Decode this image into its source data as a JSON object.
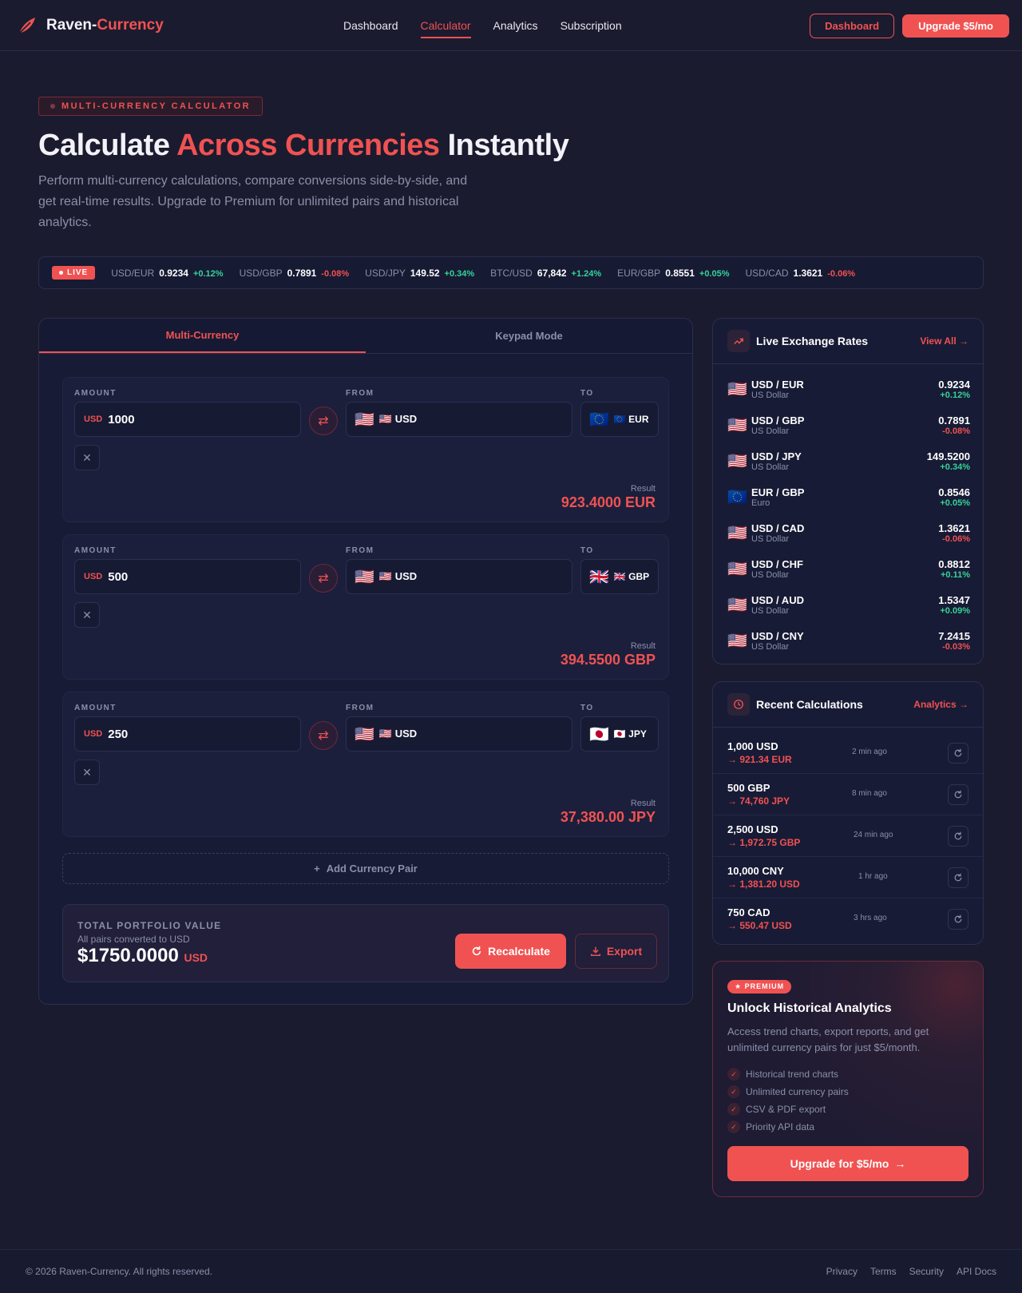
{
  "brand": {
    "name_a": "Raven-",
    "name_b": "Currency"
  },
  "nav": {
    "links": [
      "Dashboard",
      "Calculator",
      "Analytics",
      "Subscription"
    ],
    "dashboard_btn": "Dashboard",
    "upgrade_btn": "Upgrade $5/mo"
  },
  "hero": {
    "badge": "MULTI-CURRENCY CALCULATOR",
    "title_a": "Calculate ",
    "title_b": "Across Currencies",
    "title_c": " Instantly",
    "subtitle": "Perform multi-currency calculations, compare conversions side-by-side, and get real-time results. Upgrade to Premium for unlimited pairs and historical analytics."
  },
  "ticker": {
    "live": "LIVE",
    "items": [
      {
        "pair": "USD/EUR",
        "value": "0.9234",
        "change": "+0.12%",
        "dir": "up"
      },
      {
        "pair": "USD/GBP",
        "value": "0.7891",
        "change": "-0.08%",
        "dir": "down"
      },
      {
        "pair": "USD/JPY",
        "value": "149.52",
        "change": "+0.34%",
        "dir": "up"
      },
      {
        "pair": "BTC/USD",
        "value": "67,842",
        "change": "+1.24%",
        "dir": "up"
      },
      {
        "pair": "EUR/GBP",
        "value": "0.8551",
        "change": "+0.05%",
        "dir": "up"
      },
      {
        "pair": "USD/CAD",
        "value": "1.3621",
        "change": "-0.06%",
        "dir": "down"
      }
    ]
  },
  "calculator": {
    "tabs": [
      "Multi-Currency",
      "Keypad Mode"
    ],
    "labels": {
      "amount": "AMOUNT",
      "from": "FROM",
      "to": "TO",
      "result": "Result"
    },
    "pairs": [
      {
        "amount_cur": "USD",
        "amount": "1000",
        "from_flag": "🇺🇸",
        "from": "🇺🇸 USD",
        "to_flag": "🇪🇺",
        "to": "🇪🇺 EUR",
        "result": "923.4000 EUR"
      },
      {
        "amount_cur": "USD",
        "amount": "500",
        "from_flag": "🇺🇸",
        "from": "🇺🇸 USD",
        "to_flag": "🇬🇧",
        "to": "🇬🇧 GBP",
        "result": "394.5500 GBP"
      },
      {
        "amount_cur": "USD",
        "amount": "250",
        "from_flag": "🇺🇸",
        "from": "🇺🇸 USD",
        "to_flag": "🇯🇵",
        "to": "🇯🇵 JPY",
        "result": "37,380.00 JPY"
      }
    ],
    "add_pair": "Add Currency Pair",
    "total": {
      "title": "TOTAL PORTFOLIO VALUE",
      "sub": "All pairs converted to USD",
      "value": "$1750.0000",
      "unit": "USD"
    },
    "recalc_btn": "Recalculate",
    "export_btn": "Export"
  },
  "rates": {
    "title": "Live Exchange Rates",
    "view_all": "View All →",
    "items": [
      {
        "flag": "🇺🇸",
        "pair": "USD / EUR",
        "name": "US Dollar",
        "value": "0.9234",
        "change": "+0.12%",
        "dir": "up"
      },
      {
        "flag": "🇺🇸",
        "pair": "USD / GBP",
        "name": "US Dollar",
        "value": "0.7891",
        "change": "-0.08%",
        "dir": "down"
      },
      {
        "flag": "🇺🇸",
        "pair": "USD / JPY",
        "name": "US Dollar",
        "value": "149.5200",
        "change": "+0.34%",
        "dir": "up"
      },
      {
        "flag": "🇪🇺",
        "pair": "EUR / GBP",
        "name": "Euro",
        "value": "0.8546",
        "change": "+0.05%",
        "dir": "up"
      },
      {
        "flag": "🇺🇸",
        "pair": "USD / CAD",
        "name": "US Dollar",
        "value": "1.3621",
        "change": "-0.06%",
        "dir": "down"
      },
      {
        "flag": "🇺🇸",
        "pair": "USD / CHF",
        "name": "US Dollar",
        "value": "0.8812",
        "change": "+0.11%",
        "dir": "up"
      },
      {
        "flag": "🇺🇸",
        "pair": "USD / AUD",
        "name": "US Dollar",
        "value": "1.5347",
        "change": "+0.09%",
        "dir": "up"
      },
      {
        "flag": "🇺🇸",
        "pair": "USD / CNY",
        "name": "US Dollar",
        "value": "7.2415",
        "change": "-0.03%",
        "dir": "down"
      }
    ]
  },
  "recent": {
    "title": "Recent Calculations",
    "link": "Analytics →",
    "items": [
      {
        "amount": "1,000 USD",
        "result": "→ 921.34 EUR",
        "time": "2 min ago"
      },
      {
        "amount": "500 GBP",
        "result": "→ 74,760 JPY",
        "time": "8 min ago"
      },
      {
        "amount": "2,500 USD",
        "result": "→ 1,972.75 GBP",
        "time": "24 min ago"
      },
      {
        "amount": "10,000 CNY",
        "result": "→ 1,381.20 USD",
        "time": "1 hr ago"
      },
      {
        "amount": "750 CAD",
        "result": "→ 550.47 USD",
        "time": "3 hrs ago"
      }
    ]
  },
  "premium": {
    "badge": "★ PREMIUM",
    "title": "Unlock Historical Analytics",
    "desc": "Access trend charts, export reports, and get unlimited currency pairs for just $5/month.",
    "features": [
      "Historical trend charts",
      "Unlimited currency pairs",
      "CSV & PDF export",
      "Priority API data"
    ],
    "cta": "Upgrade for $5/mo"
  },
  "footer": {
    "copyright": "© 2026 Raven-Currency. All rights reserved.",
    "links": [
      "Privacy",
      "Terms",
      "Security",
      "API Docs"
    ]
  }
}
